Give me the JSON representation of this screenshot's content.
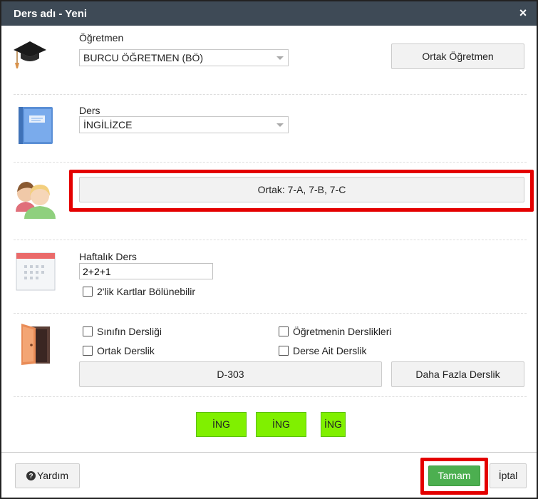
{
  "dialog": {
    "title": "Ders adı - Yeni",
    "close_label": "×"
  },
  "teacher": {
    "label": "Öğretmen",
    "value": "BURCU ÖĞRETMEN (BÖ)",
    "shared_button": "Ortak Öğretmen"
  },
  "subject": {
    "label": "Ders",
    "value": "İNGİLİZCE"
  },
  "classes": {
    "button": "Ortak: 7-A, 7-B, 7-C"
  },
  "weekly": {
    "label": "Haftalık Ders",
    "value": "2+2+1",
    "split_cards_label": "2'lik Kartlar Bölünebilir"
  },
  "rooms": {
    "class_room_label": "Sınıfın Dersliği",
    "teacher_rooms_label": "Öğretmenin Derslikleri",
    "shared_room_label": "Ortak Derslik",
    "subject_room_label": "Derse Ait Derslik",
    "room_button": "D-303",
    "more_rooms_button": "Daha Fazla Derslik"
  },
  "cards": [
    "İNG",
    "İNG",
    "İNG"
  ],
  "footer": {
    "help_label": "Yardım",
    "ok_label": "Tamam",
    "cancel_label": "İptal"
  },
  "colors": {
    "titlebar": "#3e4a56",
    "highlight": "#e40000",
    "card_green": "#80f000",
    "ok_green": "#4caf50"
  }
}
